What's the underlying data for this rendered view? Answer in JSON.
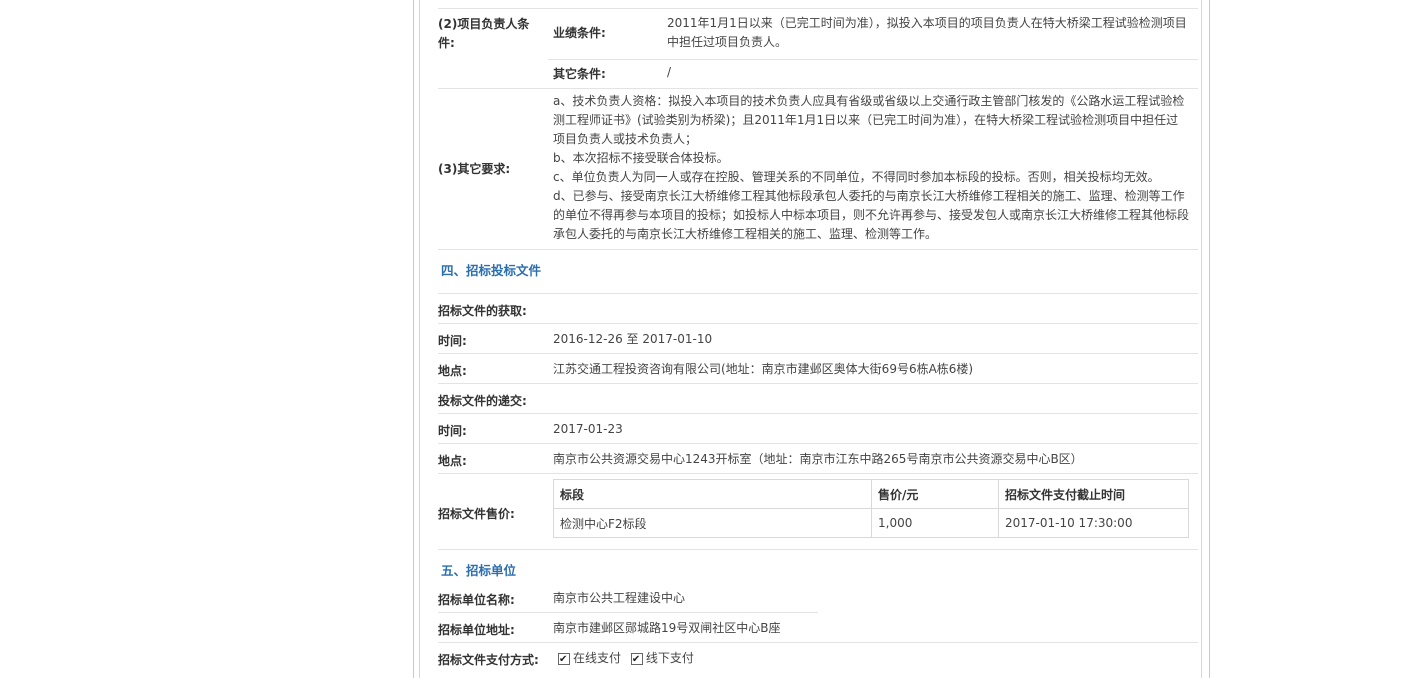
{
  "req": {
    "leader_label": "(2)项目负责人条件:",
    "perf_label": "业绩条件:",
    "perf_value": "2011年1月1日以来（已完工时间为准），拟投入本项目的项目负责人在特大桥梁工程试验检测项目中担任过项目负责人。",
    "other_cond_label": "其它条件:",
    "other_cond_value": "/",
    "other_req_label": "(3)其它要求:",
    "other_req_lines": [
      "a、技术负责人资格：拟投入本项目的技术负责人应具有省级或省级以上交通行政主管部门核发的《公路水运工程试验检",
      "测工程师证书》(试验类别为桥梁)；且2011年1月1日以来（已完工时间为准），在特大桥梁工程试验检测项目中担任过",
      "项目负责人或技术负责人；",
      "b、本次招标不接受联合体投标。",
      "c、单位负责人为同一人或存在控股、管理关系的不同单位，不得同时参加本标段的投标。否则，相关投标均无效。",
      "d、已参与、接受南京长江大桥维修工程其他标段承包人委托的与南京长江大桥维修工程相关的施工、监理、检测等工作",
      "的单位不得再参与本项目的投标；如投标人中标本项目，则不允许再参与、接受发包人或南京长江大桥维修工程其他标段",
      "承包人委托的与南京长江大桥维修工程相关的施工、监理、检测等工作。"
    ]
  },
  "section4": {
    "title": "四、招标投标文件",
    "obtain_label": "招标文件的获取:",
    "time_label": "时间:",
    "time_value": "2016-12-26 至 2017-01-10",
    "place_label": "地点:",
    "place_value": "江苏交通工程投资咨询有限公司(地址：南京市建邺区奥体大街69号6栋A栋6楼)",
    "submit_label": "投标文件的递交:",
    "submit_time_label": "时间:",
    "submit_time_value": "2017-01-23",
    "submit_place_label": "地点:",
    "submit_place_value": "南京市公共资源交易中心1243开标室（地址：南京市江东中路265号南京市公共资源交易中心B区）",
    "price_label": "招标文件售价:",
    "table": {
      "headers": [
        "标段",
        "售价/元",
        "招标文件支付截止时间"
      ],
      "rows": [
        [
          "检测中心F2标段",
          "1,000",
          "2017-01-10 17:30:00"
        ]
      ]
    }
  },
  "section5": {
    "title": "五、招标单位",
    "name_label": "招标单位名称:",
    "name_value": "南京市公共工程建设中心",
    "addr_label": "招标单位地址:",
    "addr_value": "南京市建邺区郧城路19号双闸社区中心B座",
    "pay_label": "招标文件支付方式:",
    "pay_online": "在线支付",
    "pay_offline": "线下支付"
  }
}
